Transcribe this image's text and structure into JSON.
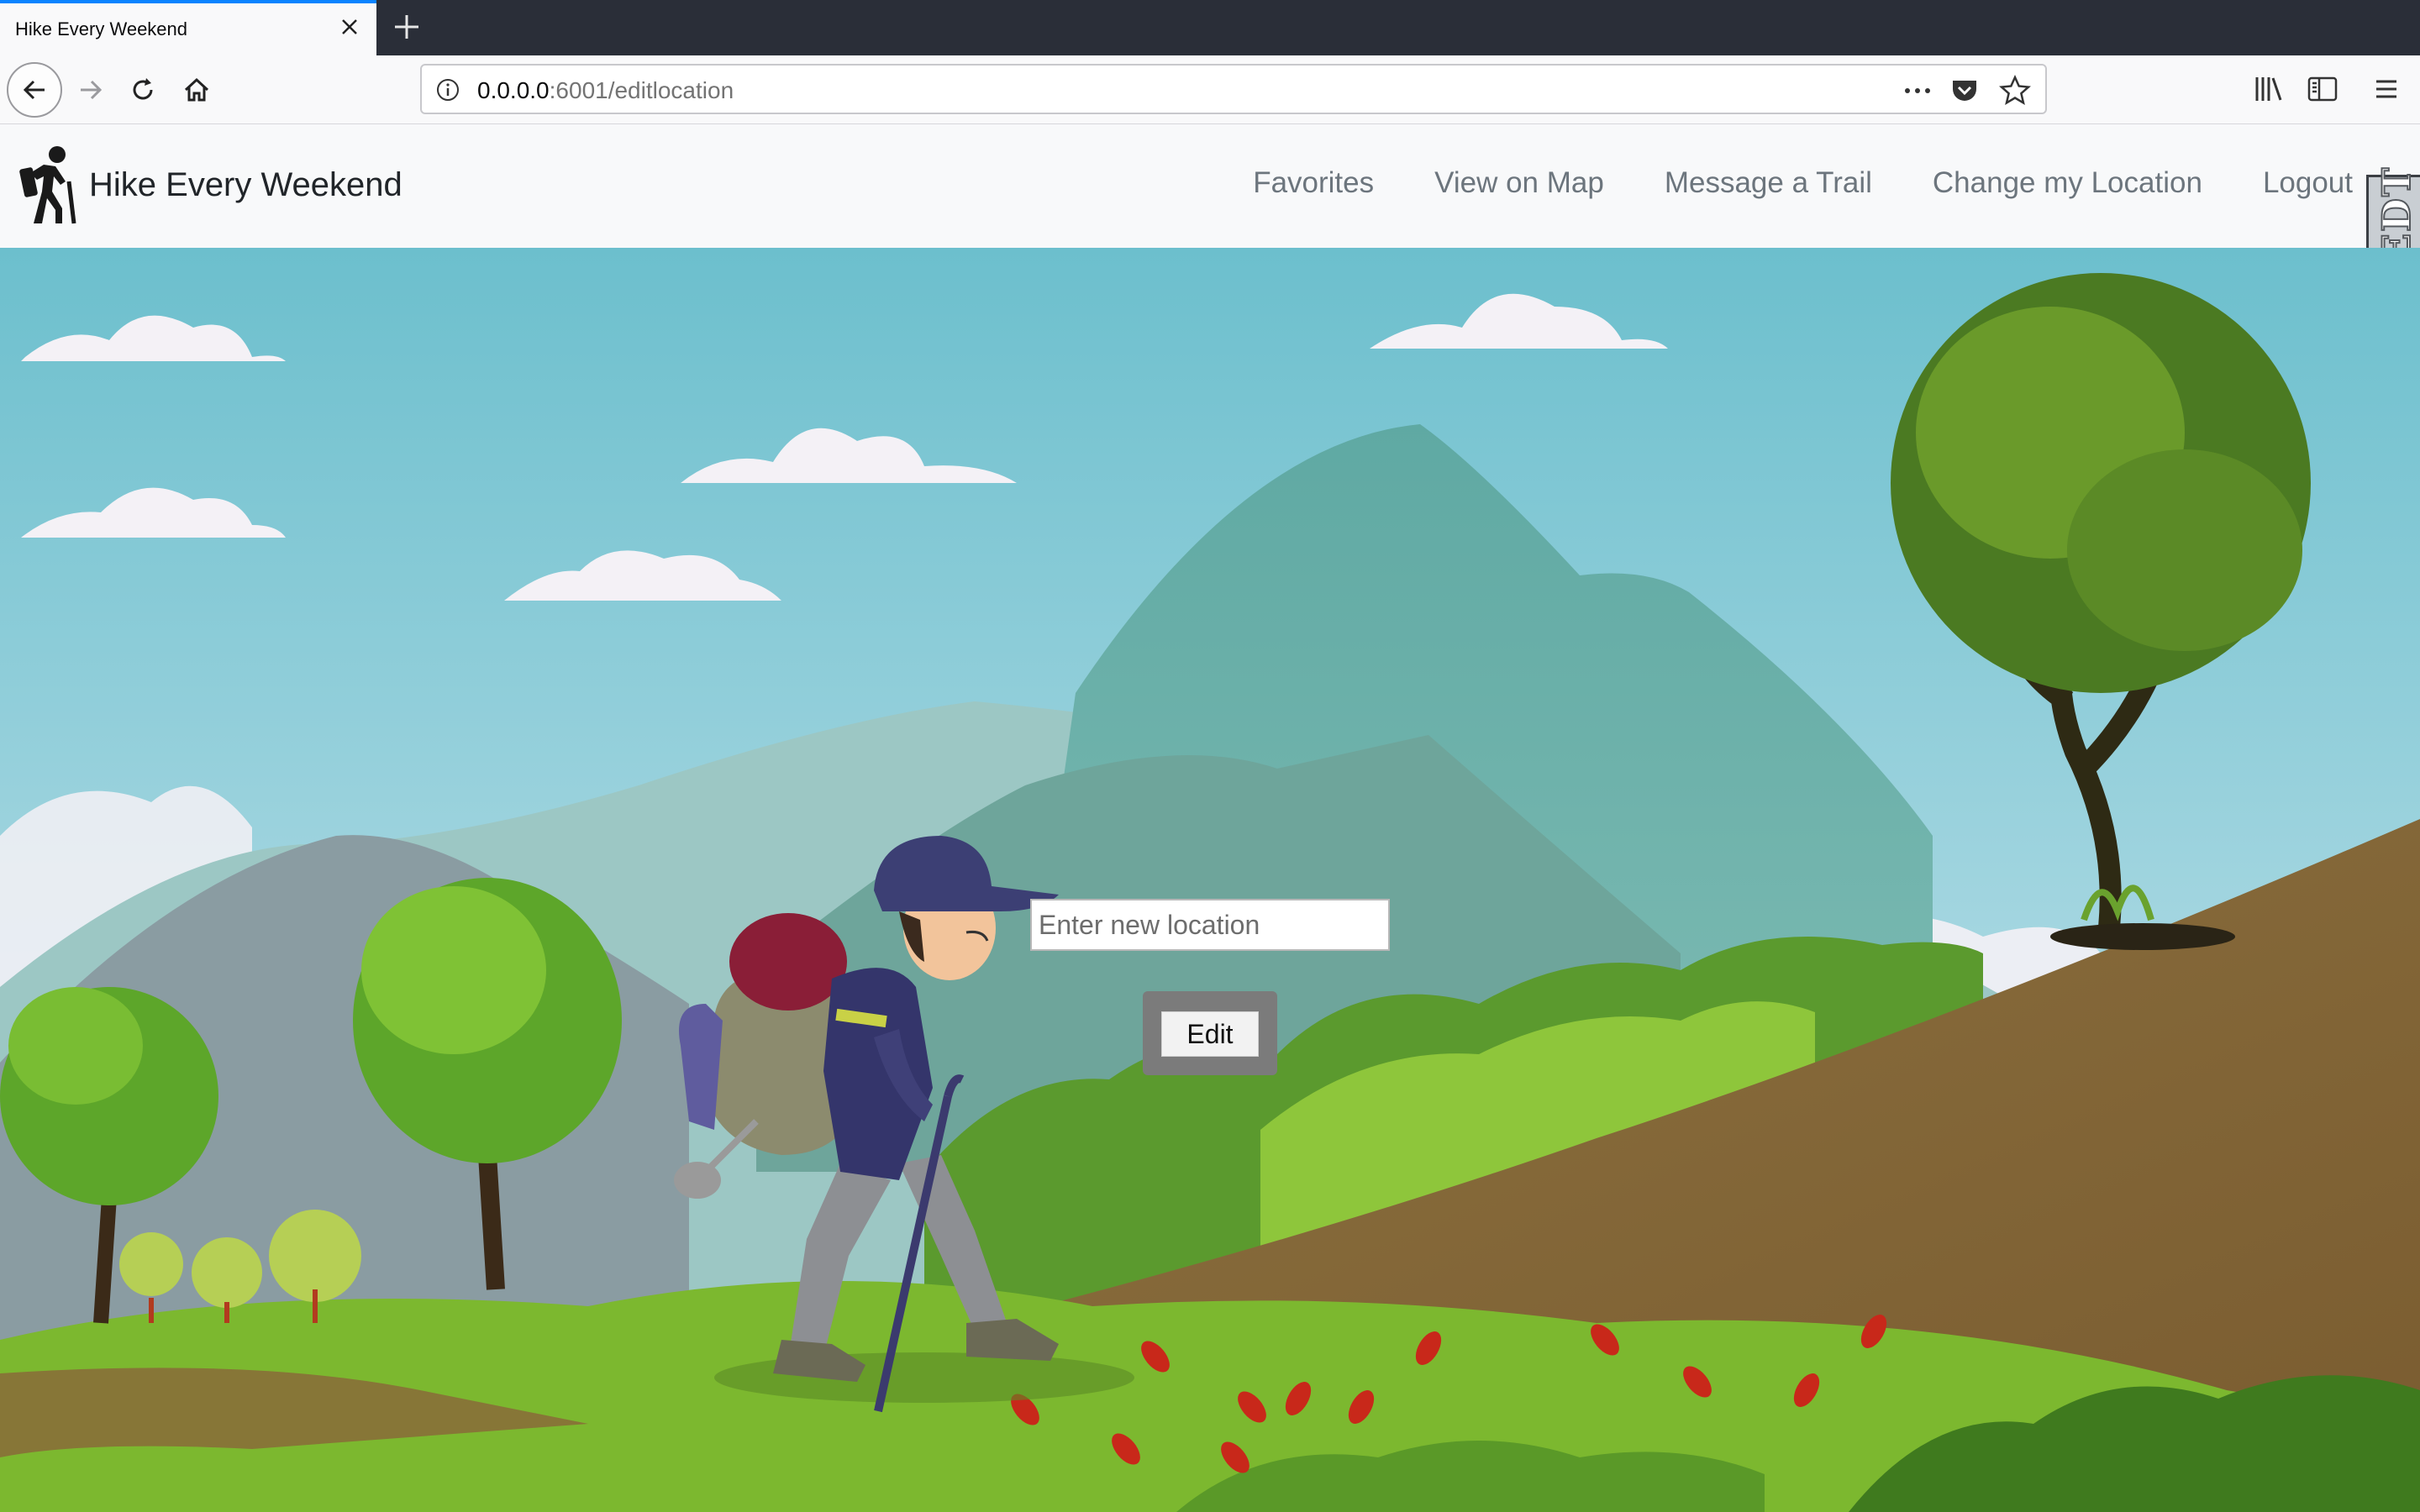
{
  "browser": {
    "tab_title": "Hike Every Weekend",
    "url_host": "0.0.0.0",
    "url_rest": ":6001/editlocation",
    "toolbar_icons": [
      "back-icon",
      "forward-icon",
      "reload-icon",
      "home-icon",
      "info-icon",
      "more-icon",
      "pocket-icon",
      "bookmark-star-icon",
      "library-icon",
      "sidebar-icon",
      "menu-icon"
    ]
  },
  "site": {
    "brand": "Hike Every Weekend",
    "nav": {
      "favorites": "Favorites",
      "map": "View on Map",
      "message": "Message a Trail",
      "location": "Change my Location",
      "logout": "Logout"
    },
    "badge": "EDT"
  },
  "form": {
    "placeholder": "Enter new location",
    "value": "",
    "button": "Edit"
  },
  "colors": {
    "sky_top": "#6fc1cf",
    "sky_bottom": "#b7dde5",
    "hill_green": "#7cb82f",
    "hill_brown": "#8a6a38",
    "button_frame": "#7b7b7b"
  }
}
